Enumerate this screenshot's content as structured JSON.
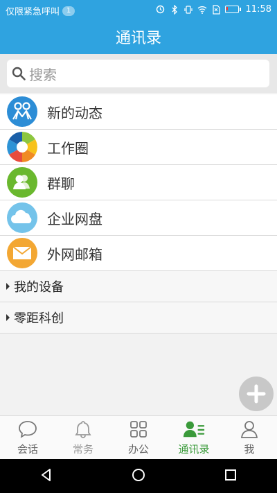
{
  "status": {
    "emergency_text": "仅限紧急呼叫",
    "badge": "1",
    "time": "11:58",
    "battery_level": 0.15
  },
  "header": {
    "title": "通讯录"
  },
  "search": {
    "placeholder": "搜索"
  },
  "items": [
    {
      "label": "新的动态",
      "icon": "people-icon",
      "color": "#2c8dd6"
    },
    {
      "label": "工作圈",
      "icon": "aperture-icon",
      "color": "#ffffff"
    },
    {
      "label": "群聊",
      "icon": "group-icon",
      "color": "#6ab82e"
    },
    {
      "label": "企业网盘",
      "icon": "cloud-icon",
      "color": "#74c3ea"
    },
    {
      "label": "外网邮箱",
      "icon": "mail-icon",
      "color": "#f3a733"
    }
  ],
  "groups": [
    {
      "label": "我的设备"
    },
    {
      "label": "零距科创"
    }
  ],
  "tabs": [
    {
      "label": "会话",
      "icon": "chat-icon",
      "active": false
    },
    {
      "label": "常务",
      "icon": "bell-icon",
      "active": false
    },
    {
      "label": "办公",
      "icon": "grid-icon",
      "active": false
    },
    {
      "label": "通讯录",
      "icon": "contacts-icon",
      "active": true
    },
    {
      "label": "我",
      "icon": "person-icon",
      "active": false
    }
  ],
  "colors": {
    "brand": "#2fa3e0",
    "active_tab": "#3a9a3a"
  }
}
